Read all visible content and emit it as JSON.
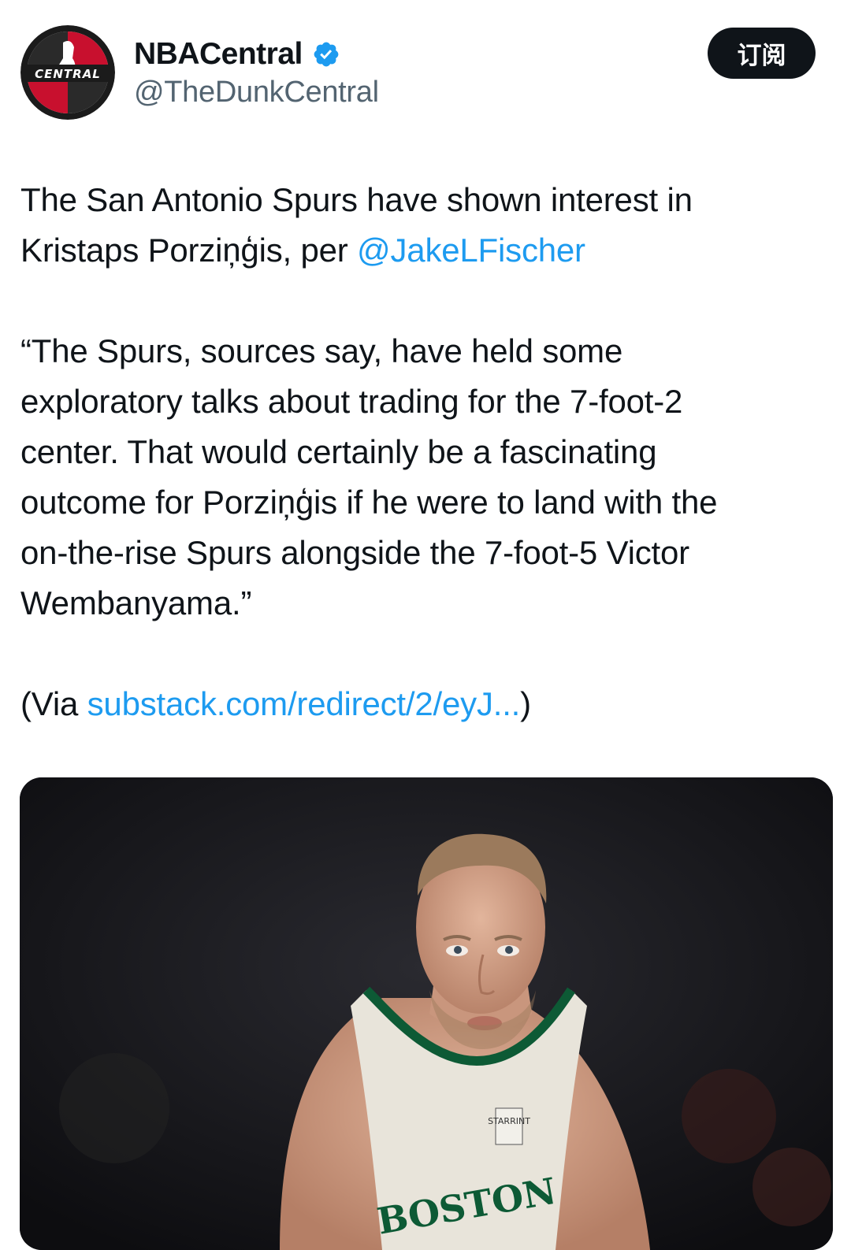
{
  "author": {
    "display_name": "NBACentral",
    "handle": "@TheDunkCentral",
    "avatar_text": "CENTRAL",
    "verified_icon": "verified-badge-icon"
  },
  "subscribe_button": {
    "label": "订阅"
  },
  "tweet": {
    "line1_a": "The San Antonio Spurs have shown interest in",
    "line1_b": "Kristaps Porziņģis, per ",
    "mention": "@JakeLFischer",
    "quote_lines": [
      "“The Spurs, sources say, have held some",
      "exploratory talks about trading for the 7-foot-2",
      "center. That would certainly be a fascinating",
      "outcome for Porziņģis if he were to land with the",
      "on-the-rise Spurs alongside the 7-foot-5 Victor",
      "Wembanyama.”"
    ],
    "via_prefix": "(Via ",
    "via_link": "substack.com/redirect/2/eyJ...",
    "via_suffix": ")"
  },
  "media": {
    "description_icon": "player-photo",
    "jersey_text": "BOSTON",
    "sponsor_text": "STARRINT"
  },
  "colors": {
    "text": "#0f1419",
    "secondary": "#536471",
    "link": "#1d9bf0",
    "verified": "#1d9bf0",
    "button_bg": "#0f1419"
  }
}
